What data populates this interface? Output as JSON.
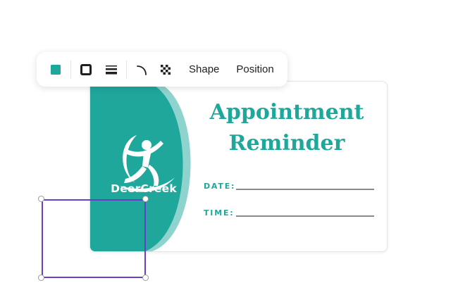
{
  "toolbar": {
    "fill_color": "#1fa79b",
    "items": [
      {
        "icon": "fill-color-icon"
      },
      {
        "icon": "border-style-icon"
      },
      {
        "icon": "border-weight-icon"
      },
      {
        "icon": "corner-rounding-icon"
      },
      {
        "icon": "transparency-icon"
      }
    ],
    "shape_label": "Shape",
    "position_label": "Position"
  },
  "card": {
    "brand_name": "DeerCreek",
    "title_line1": "Appointment",
    "title_line2": "Reminder",
    "date_label": "DATE:",
    "time_label": "TIME:",
    "primary_color": "#1fa79b",
    "secondary_color": "#8fd3ce"
  },
  "selection": {
    "border_color": "#6a3fc7"
  }
}
